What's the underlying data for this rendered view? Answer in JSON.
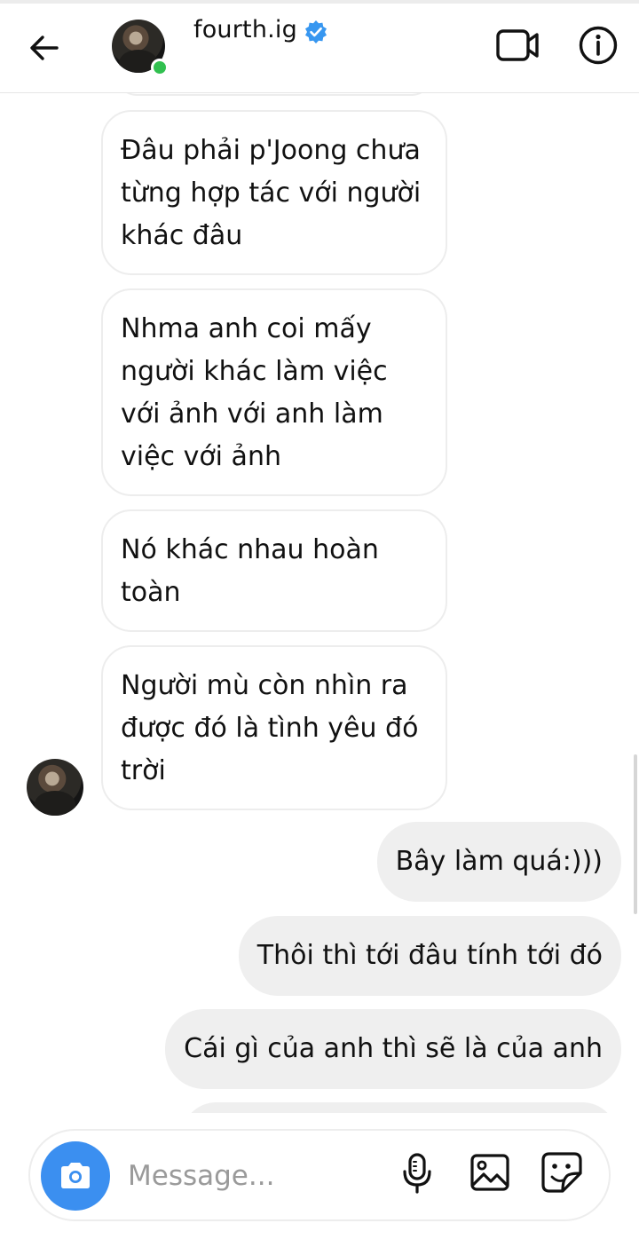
{
  "header": {
    "username": "fourth.ig",
    "verified": true,
    "online": true,
    "icons": [
      "back-arrow-icon",
      "verified-badge-icon",
      "video-call-icon",
      "info-icon"
    ]
  },
  "messages": [
    {
      "direction": "received",
      "text": "Đâu phải p'Joong chưa từng hợp tác với người khác đâu"
    },
    {
      "direction": "received",
      "text": "Nhma anh coi mấy người khác làm việc với ảnh với anh làm việc với ảnh"
    },
    {
      "direction": "received",
      "text": "Nó khác nhau hoàn toàn"
    },
    {
      "direction": "received",
      "text": "Người mù còn nhìn ra được đó là tình yêu đó trời"
    },
    {
      "direction": "sent",
      "text": "Bây làm quá:)))"
    },
    {
      "direction": "sent",
      "text": "Thôi thì tới đâu tính tới đó"
    },
    {
      "direction": "sent",
      "text": "Cái gì của anh thì sẽ là của anh"
    }
  ],
  "composer": {
    "placeholder": "Message...",
    "icons": [
      "camera-icon",
      "microphone-icon",
      "gallery-icon",
      "sticker-icon"
    ]
  },
  "colors": {
    "accent": "#3b8ff0",
    "verified": "#3897f0",
    "online": "#31c04f",
    "sent_bubble": "#efefef",
    "received_border": "#ededed"
  }
}
